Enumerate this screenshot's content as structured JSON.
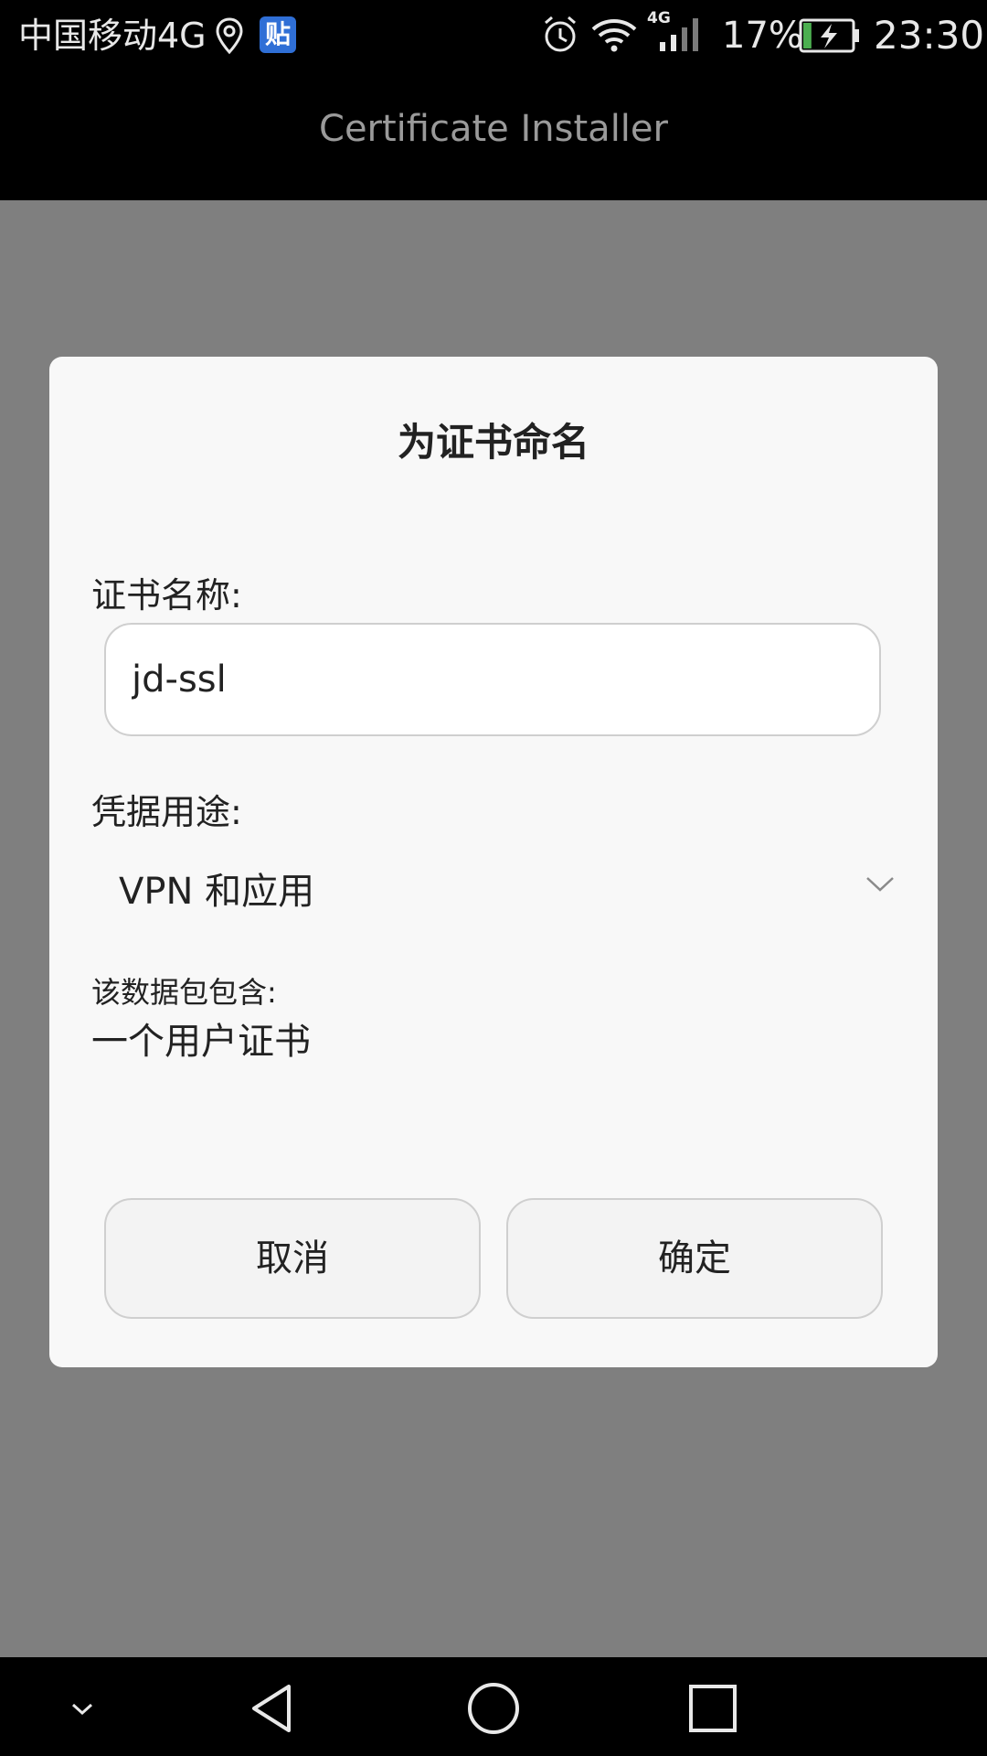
{
  "status_bar": {
    "carrier": "中国移动4G",
    "tieba_badge": "贴",
    "network_type": "4G",
    "battery_percent": "17%",
    "battery_level": 0.17,
    "time": "23:30",
    "icons": [
      "location-icon",
      "tieba-icon",
      "alarm-icon",
      "wifi-icon",
      "signal-icon",
      "battery-charging-icon"
    ]
  },
  "app_bar": {
    "title": "Certificate Installer"
  },
  "dialog": {
    "title": "为证书命名",
    "name_label": "证书名称:",
    "name_value": "jd-ssl",
    "usage_label": "凭据用途:",
    "usage_value": "VPN 和应用",
    "contents_label": "该数据包包含:",
    "contents_value": "一个用户证书",
    "cancel_label": "取消",
    "ok_label": "确定"
  },
  "nav_bar": {
    "icons": [
      "chevron-down-icon",
      "back-icon",
      "home-icon",
      "recents-icon"
    ]
  },
  "colors": {
    "scrim": "#7f7f7f",
    "dialog_bg": "#f8f8f8",
    "bars": "#000000",
    "battery_fill": "#4caf50",
    "tieba_blue": "#2f6fd6"
  }
}
